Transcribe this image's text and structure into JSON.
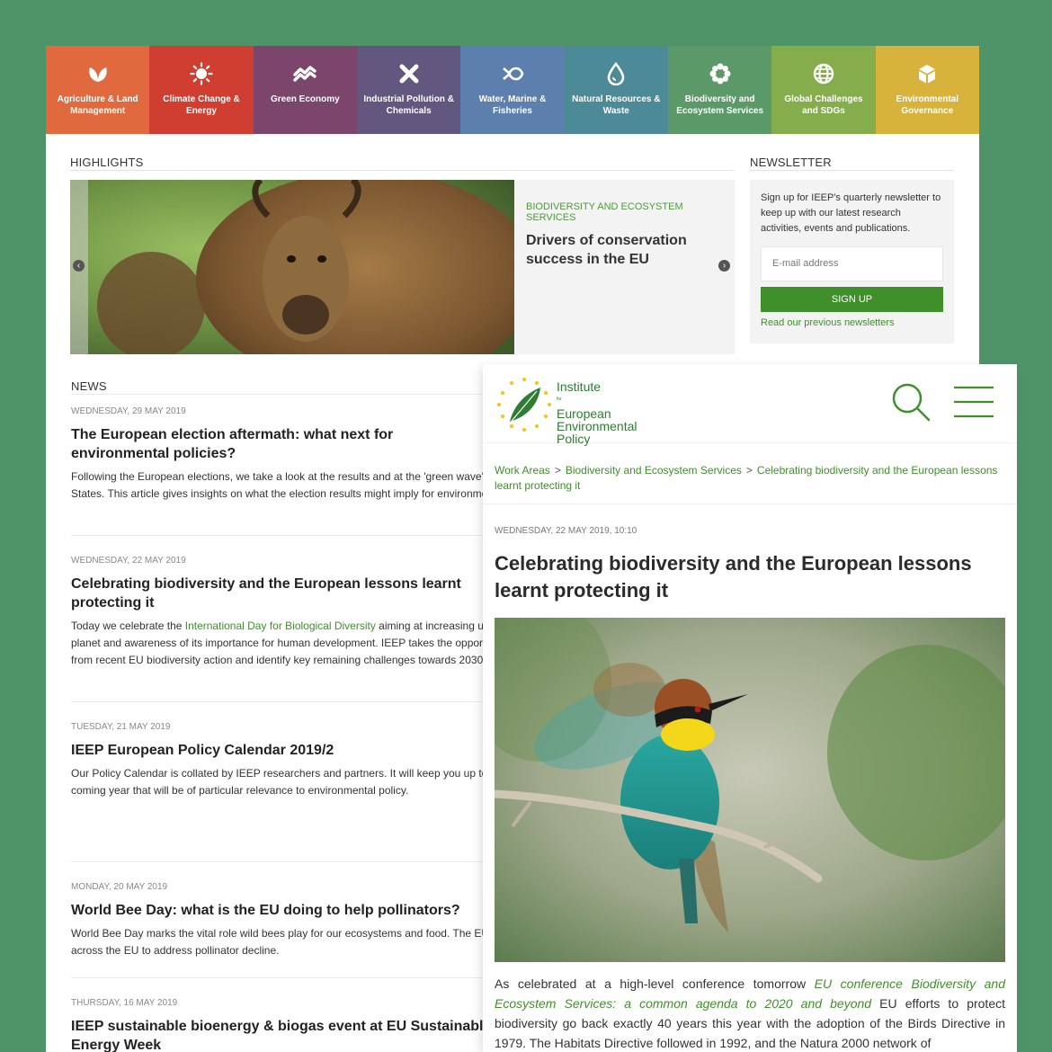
{
  "nav": [
    {
      "label": "Agriculture & Land Management",
      "icon": "leaf-icon",
      "color": "#e06a3d"
    },
    {
      "label": "Climate Change & Energy",
      "icon": "sun-icon",
      "color": "#cf3e31"
    },
    {
      "label": "Green Economy",
      "icon": "wave-icon",
      "color": "#7b456c"
    },
    {
      "label": "Industrial Pollution & Chemicals",
      "icon": "cross-icon",
      "color": "#62577f"
    },
    {
      "label": "Water, Marine & Fisheries",
      "icon": "fish-icon",
      "color": "#5d7fad"
    },
    {
      "label": "Natural Resources & Waste",
      "icon": "drop-icon",
      "color": "#4d8a97"
    },
    {
      "label": "Biodiversity and Ecosystem Services",
      "icon": "flower-icon",
      "color": "#5c9968"
    },
    {
      "label": "Global Challenges and SDGs",
      "icon": "globe-icon",
      "color": "#86ad4c"
    },
    {
      "label": "Environmental Governance",
      "icon": "cube-icon",
      "color": "#d7b33c"
    }
  ],
  "highlights": {
    "heading": "HIGHLIGHTS",
    "kicker": "BIODIVERSITY AND ECOSYSTEM SERVICES",
    "title": "Drivers of conservation success in the EU"
  },
  "newsletter": {
    "heading": "NEWSLETTER",
    "text": "Sign up for IEEP's quarterly newsletter to keep up with our latest research activities, events and publications.",
    "email_placeholder": "E-mail address",
    "signup_label": "SIGN UP",
    "previous_link": "Read our previous newsletters"
  },
  "news": {
    "heading": "NEWS",
    "items": [
      {
        "date": "WEDNESDAY, 29 MAY 2019",
        "title": "The European election aftermath: what next for environmental policies?",
        "excerpt": "Following the European elections, we take a look at the results and at the 'green wave' that swept across some of the Member States. This article gives insights on what the election results might imply for environmental policies at the European level."
      },
      {
        "date": "WEDNESDAY, 22 MAY 2019",
        "title": "Celebrating biodiversity and the European lessons learnt protecting it",
        "excerpt_before": "Today we celebrate the ",
        "excerpt_link": "International Day for Biological Diversity",
        "excerpt_after": " aiming at increasing understanding of the diversity of life on the planet and awareness of its importance for human development. IEEP takes the opportunity to share some key positive lessons from recent EU biodiversity action and identify key remaining challenges towards 2030."
      },
      {
        "date": "TUESDAY, 21 MAY 2019",
        "title": "IEEP European Policy Calendar 2019/2",
        "excerpt": "Our Policy Calendar is collated by IEEP researchers and partners. It will keep you up to date about key events and dates in the coming year that will be of particular relevance to environmental policy."
      },
      {
        "date": "MONDAY, 20 MAY 2019",
        "title": "World Bee Day: what is the EU doing to help pollinators?",
        "excerpt": "World Bee Day marks the vital role wild bees play for our ecosystems and food. The EU Pollinators Initiative is promoting actions across the EU to address pollinator decline."
      },
      {
        "date": "THURSDAY, 16 MAY 2019",
        "title": "IEEP sustainable bioenergy & biogas event at EU Sustainable Energy Week"
      }
    ]
  },
  "article": {
    "logo": {
      "line1": "Institute",
      "small": "for",
      "line2": "European",
      "line3": "Environmental",
      "line4": "Policy"
    },
    "breadcrumb": [
      "Work Areas",
      "Biodiversity and Ecosystem Services",
      "Celebrating biodiversity and the European lessons learnt protecting it"
    ],
    "breadcrumb_sep": ">",
    "date": "WEDNESDAY, 22 MAY 2019, 10:10",
    "title": "Celebrating biodiversity and the European lessons learnt protecting it",
    "body_before": "As celebrated at a high-level conference tomorrow ",
    "body_link": "EU conference Biodiversity and Ecosystem Services: a common agenda to 2020 and beyond",
    "body_after": "  EU efforts to protect biodiversity go back exactly 40 years this year with the adoption of the Birds Directive in 1979. The Habitats Directive followed in 1992, and the Natura 2000 network of"
  },
  "colors": {
    "background": "#4e9468",
    "accent_green": "#3f8f2b",
    "link_green": "#4d9a3b"
  }
}
